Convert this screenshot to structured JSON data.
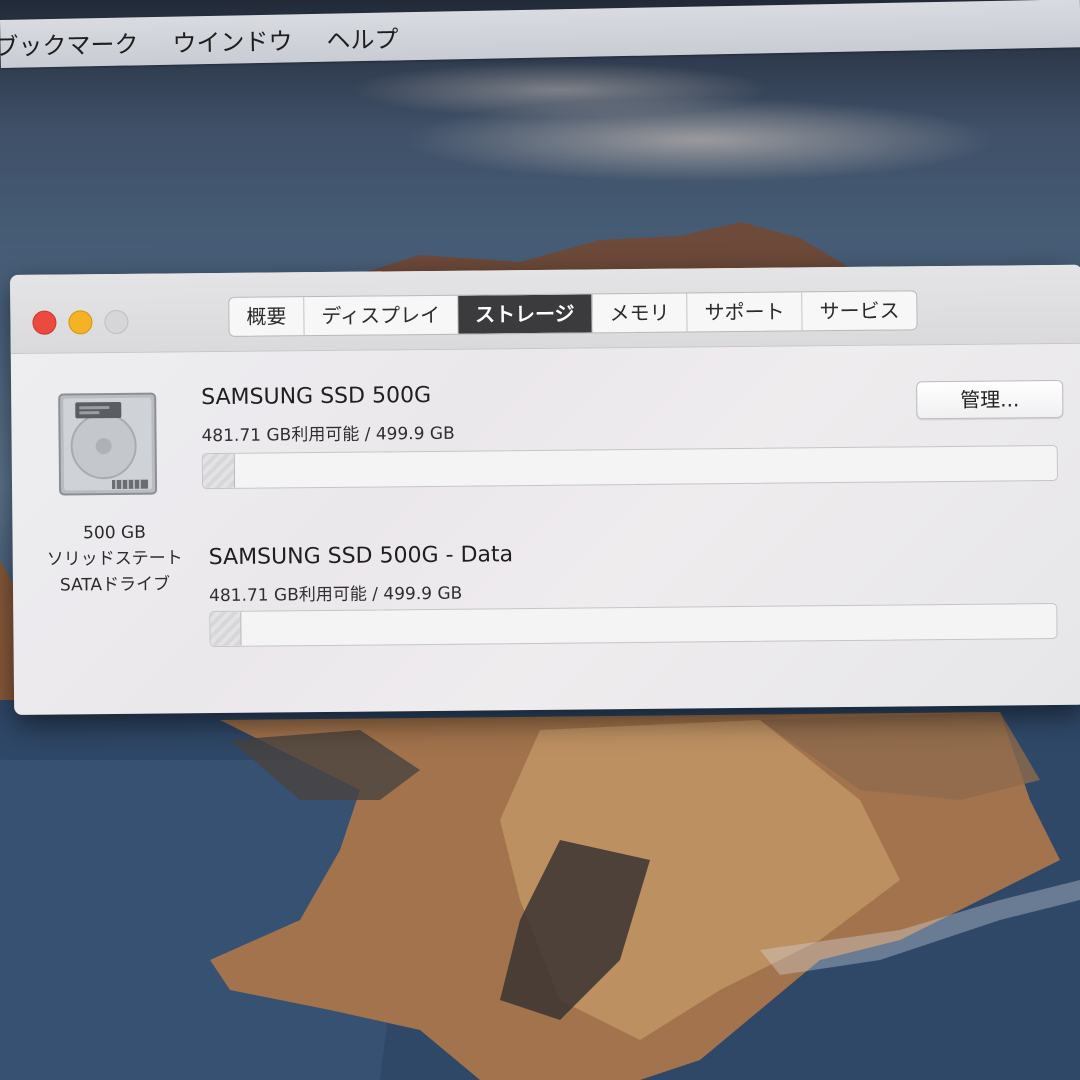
{
  "menubar": {
    "items": [
      "ブックマーク",
      "ウインドウ",
      "ヘルプ"
    ]
  },
  "window": {
    "tabs": [
      {
        "label": "概要",
        "active": false
      },
      {
        "label": "ディスプレイ",
        "active": false
      },
      {
        "label": "ストレージ",
        "active": true
      },
      {
        "label": "メモリ",
        "active": false
      },
      {
        "label": "サポート",
        "active": false
      },
      {
        "label": "サービス",
        "active": false
      }
    ],
    "drive": {
      "icon": "hard-drive-icon",
      "capacity": "500 GB",
      "type_line1": "ソリッドステート",
      "type_line2": "SATAドライブ"
    },
    "manage_button": "管理...",
    "volumes": [
      {
        "name": "SAMSUNG SSD 500G",
        "info": "481.71 GB利用可能 / 499.9 GB",
        "used_fraction": 0.036
      },
      {
        "name": "SAMSUNG SSD 500G - Data",
        "info": "481.71 GB利用可能 / 499.9 GB",
        "used_fraction": 0.036
      }
    ]
  },
  "colors": {
    "close": "#ec4a3e",
    "minimize": "#f4b224",
    "zoom_disabled": "#d6d6d8",
    "active_tab": "#3b3b3d"
  }
}
